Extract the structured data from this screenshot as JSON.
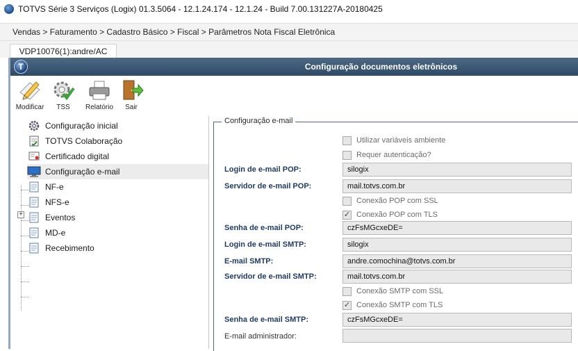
{
  "titlebar": {
    "title": "TOTVS Série 3 Serviços (Logix) 01.3.5064  -  12.1.24.174 - 12.1.24 - Build 7.00.131227A-20180425"
  },
  "breadcrumb": "Vendas > Faturamento > Cadastro Básico > Fiscal > Parâmetros Nota Fiscal Eletrônica",
  "tab": {
    "label": "VDP10076(1):andre/AC"
  },
  "window": {
    "title": "Configuração documentos eletrônicos",
    "logo_letter": "T"
  },
  "toolbar": {
    "modificar": "Modificar",
    "tss": "TSS",
    "relatorio": "Relatório",
    "sair": "Sair"
  },
  "tree": {
    "items": [
      {
        "label": "Configuração inicial",
        "icon": "gear-icon"
      },
      {
        "label": "TOTVS Colaboração",
        "icon": "document-check-icon"
      },
      {
        "label": "Certificado digital",
        "icon": "certificate-icon"
      },
      {
        "label": "Configuração e-mail",
        "icon": "monitor-icon"
      },
      {
        "label": "NF-e",
        "icon": "document-icon"
      },
      {
        "label": "NFS-e",
        "icon": "document-icon"
      },
      {
        "label": "Eventos",
        "icon": "document-icon"
      },
      {
        "label": "MD-e",
        "icon": "document-icon"
      },
      {
        "label": "Recebimento",
        "icon": "document-icon"
      }
    ],
    "expand_symbol": "+"
  },
  "form": {
    "group_title": "Configuração e-mail",
    "chk_variaveis": {
      "label": "Utilizar variáveis ambiente",
      "checked": false
    },
    "chk_autenticacao": {
      "label": "Requer autenticação?",
      "checked": false
    },
    "login_pop": {
      "label": "Login de e-mail POP:",
      "value": "silogix"
    },
    "servidor_pop": {
      "label": "Servidor de e-mail POP:",
      "value": "mail.totvs.com.br"
    },
    "chk_pop_ssl": {
      "label": "Conexão POP com SSL",
      "checked": false
    },
    "chk_pop_tls": {
      "label": "Conexão POP com TLS",
      "checked": true,
      "mark": "✓"
    },
    "senha_pop": {
      "label": "Senha de e-mail POP:",
      "value": "czFsMGcxeDE="
    },
    "login_smtp": {
      "label": "Login de e-mail SMTP:",
      "value": "silogix"
    },
    "email_smtp": {
      "label": "E-mail SMTP:",
      "value": "andre.comochina@totvs.com.br"
    },
    "servidor_smtp": {
      "label": "Servidor de e-mail SMTP:",
      "value": "mail.totvs.com.br"
    },
    "chk_smtp_ssl": {
      "label": "Conexão SMTP com SSL",
      "checked": false
    },
    "chk_smtp_tls": {
      "label": "Conexão SMTP com TLS",
      "checked": true,
      "mark": "✓"
    },
    "senha_smtp": {
      "label": "Senha de e-mail SMTP:",
      "value": "czFsMGcxeDE="
    },
    "email_admin": {
      "label": "E-mail administrador:",
      "value": ""
    }
  },
  "colors": {
    "header": "#2f4a66",
    "label": "#1f3b66",
    "field": "#e9e9e9"
  }
}
